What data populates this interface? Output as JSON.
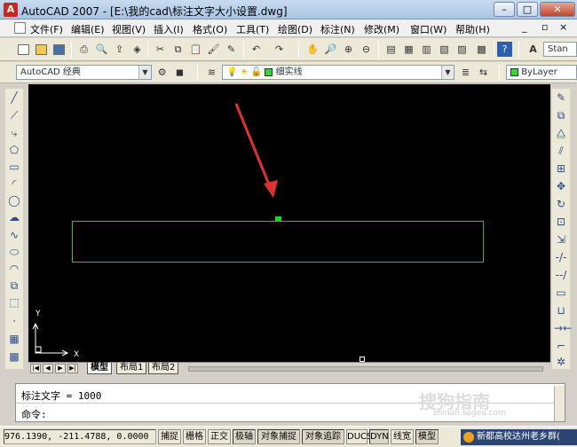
{
  "window": {
    "title": "AutoCAD 2007 - [E:\\我的cad\\标注文字大小设置.dwg]",
    "controls": {
      "minimize": "–",
      "maximize": "□",
      "close": "✕"
    }
  },
  "menu": [
    "文件(F)",
    "编辑(E)",
    "视图(V)",
    "插入(I)",
    "格式(O)",
    "工具(T)",
    "绘图(D)",
    "标注(N)",
    "修改(M)",
    "窗口(W)",
    "帮助(H)"
  ],
  "doc_controls": {
    "minimize": "_",
    "restore": "▫",
    "close": "×"
  },
  "toolbar": {
    "workspace": "AutoCAD 经典",
    "layer": "细实线",
    "color": "ByLayer",
    "text_style": "Stan"
  },
  "layout_tabs": [
    "模型",
    "布局1",
    "布局2"
  ],
  "active_tab": "模型",
  "ucs": {
    "x_label": "X",
    "y_label": "Y"
  },
  "command": {
    "history": "标注文字 = 1000",
    "prompt": "命令:"
  },
  "status": {
    "coords": "976.1390,  -211.4788, 0.0000",
    "buttons": [
      "捕捉",
      "栅格",
      "正交",
      "极轴",
      "对象捕捉",
      "对象追踪",
      "DUCS",
      "DYN",
      "线宽",
      "模型"
    ],
    "notification": "新都高校达州老乡群("
  },
  "watermark": {
    "text": "搜狗指南",
    "url": "zhinan.sogou.com"
  },
  "colors": {
    "canvas": "#000000",
    "rectangle": "#39b54a",
    "arrow": "#e03131",
    "grip": "#1fd21f"
  }
}
